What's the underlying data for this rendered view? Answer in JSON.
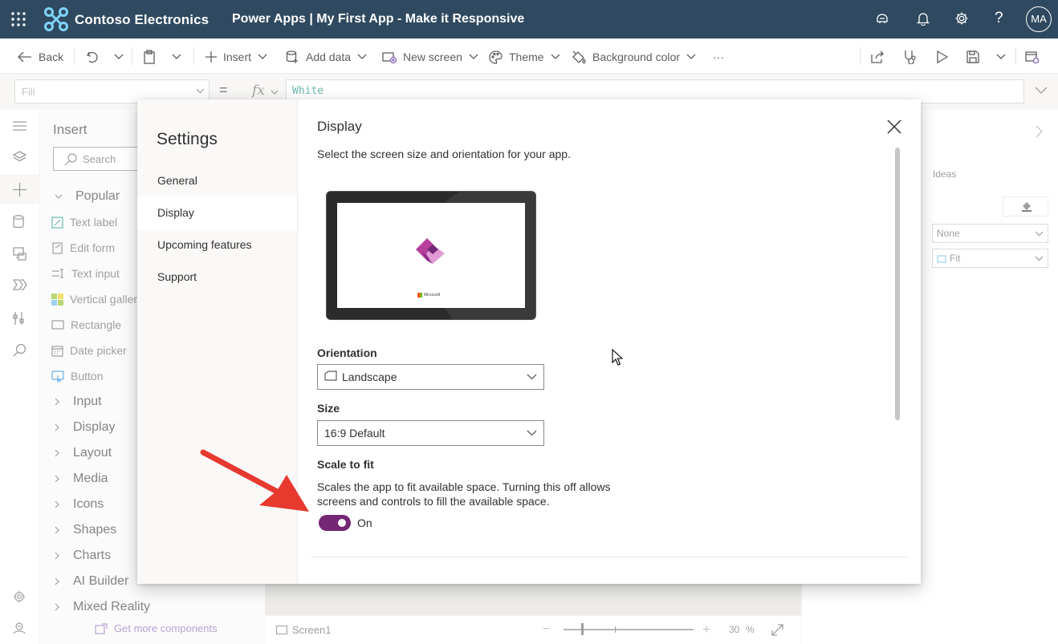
{
  "header": {
    "org_name": "Contoso Electronics",
    "app_title": "Power Apps  |  My First App - Make it Responsive",
    "avatar_initials": "MA",
    "brand_color": "#2f4a60"
  },
  "commandbar": {
    "back": "Back",
    "insert": "Insert",
    "add_data": "Add data",
    "new_screen": "New screen",
    "theme": "Theme",
    "background_color": "Background color",
    "more": "···"
  },
  "formula": {
    "property": "Fill",
    "equals": "=",
    "fx": "fx",
    "value": "White"
  },
  "insert_pane": {
    "title": "Insert",
    "search_placeholder": "Search",
    "popular": "Popular",
    "items": [
      "Text label",
      "Edit form",
      "Text input",
      "Vertical galler",
      "Rectangle",
      "Date picker",
      "Button"
    ],
    "groups": [
      "Input",
      "Display",
      "Layout",
      "Media",
      "Icons",
      "Shapes",
      "Charts",
      "AI Builder",
      "Mixed Reality"
    ],
    "get_more": "Get more components"
  },
  "statusbar": {
    "screen": "Screen1",
    "zoom_value": "30",
    "zoom_unit": "%",
    "zoom_minus": "−",
    "zoom_plus": "+"
  },
  "right_pane": {
    "ideas": "Ideas",
    "dropdown1": "None",
    "dropdown2": "Fit"
  },
  "settings": {
    "title": "Settings",
    "nav": [
      "General",
      "Display",
      "Upcoming features",
      "Support"
    ],
    "selected_nav": "Display",
    "heading": "Display",
    "description": "Select the screen size and orientation for your app.",
    "preview_brand": "Microsoft",
    "orientation_label": "Orientation",
    "orientation_value": "Landscape",
    "size_label": "Size",
    "size_value": "16:9 Default",
    "scale_label": "Scale to fit",
    "scale_desc": "Scales the app to fit available space. Turning this off allows screens and controls to fill the available space.",
    "scale_toggle": "On",
    "toggle_color": "#742774"
  }
}
